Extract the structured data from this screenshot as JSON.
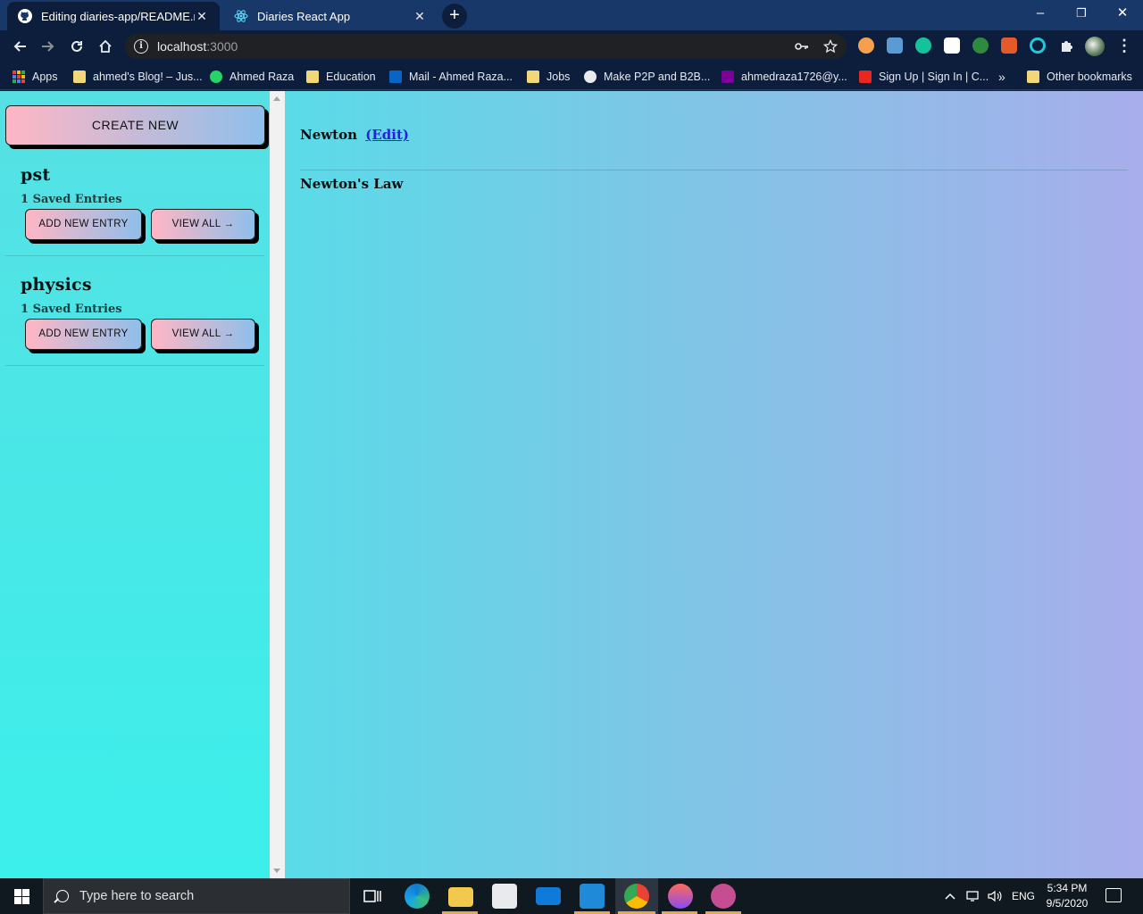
{
  "browser": {
    "tabs": [
      {
        "title": "Editing diaries-app/README.md",
        "active": true,
        "favicon": "github-icon"
      },
      {
        "title": "Diaries React App",
        "active": false,
        "favicon": "react-icon"
      }
    ],
    "close_glyph": "✕",
    "new_tab_glyph": "+",
    "window_controls": {
      "minimize": "–",
      "restore": "❐",
      "close": "✕"
    },
    "address": {
      "host": "localhost",
      "port": ":3000"
    },
    "bookmarks": [
      {
        "label": "Apps",
        "icon": "apps-grid-icon"
      },
      {
        "label": "ahmed's Blog! – Jus...",
        "icon": "folder-icon"
      },
      {
        "label": "Ahmed Raza",
        "icon": "whatsapp-icon"
      },
      {
        "label": "Education",
        "icon": "folder-icon"
      },
      {
        "label": "Mail - Ahmed Raza...",
        "icon": "outlook-icon"
      },
      {
        "label": "Jobs",
        "icon": "folder-icon"
      },
      {
        "label": "Make P2P and B2B...",
        "icon": "globe-icon"
      },
      {
        "label": "ahmedraza1726@y...",
        "icon": "yahoo-icon"
      },
      {
        "label": "Sign Up | Sign In | C...",
        "icon": "adobe-icon"
      },
      {
        "label": "»",
        "icon": "overflow-icon"
      },
      {
        "label": "Other bookmarks",
        "icon": "folder-icon"
      }
    ]
  },
  "app": {
    "create_button": "CREATE NEW",
    "diaries": [
      {
        "name": "pst",
        "count": "1 Saved Entries",
        "add_label": "ADD NEW ENTRY",
        "view_label": "VIEW ALL →"
      },
      {
        "name": "physics",
        "count": "1 Saved Entries",
        "add_label": "ADD NEW ENTRY",
        "view_label": "VIEW ALL →"
      }
    ],
    "entry": {
      "title": "Newton",
      "edit_link": "(Edit)",
      "content": "Newton's Law"
    }
  },
  "taskbar": {
    "search_placeholder": "Type here to search",
    "tray_lang": "ENG",
    "time": "5:34 PM",
    "date": "9/5/2020"
  },
  "colors": {
    "sidebar_bg": "#3cefea",
    "main_gradient_start": "#5adbe8",
    "main_gradient_end": "#a8aeeb",
    "button_gradient_start": "#ffb6c4",
    "button_gradient_end": "#8fbfeb",
    "link": "#2323d6",
    "chrome_frame": "#19386a",
    "chrome_toolbar": "#0c1e3c"
  }
}
